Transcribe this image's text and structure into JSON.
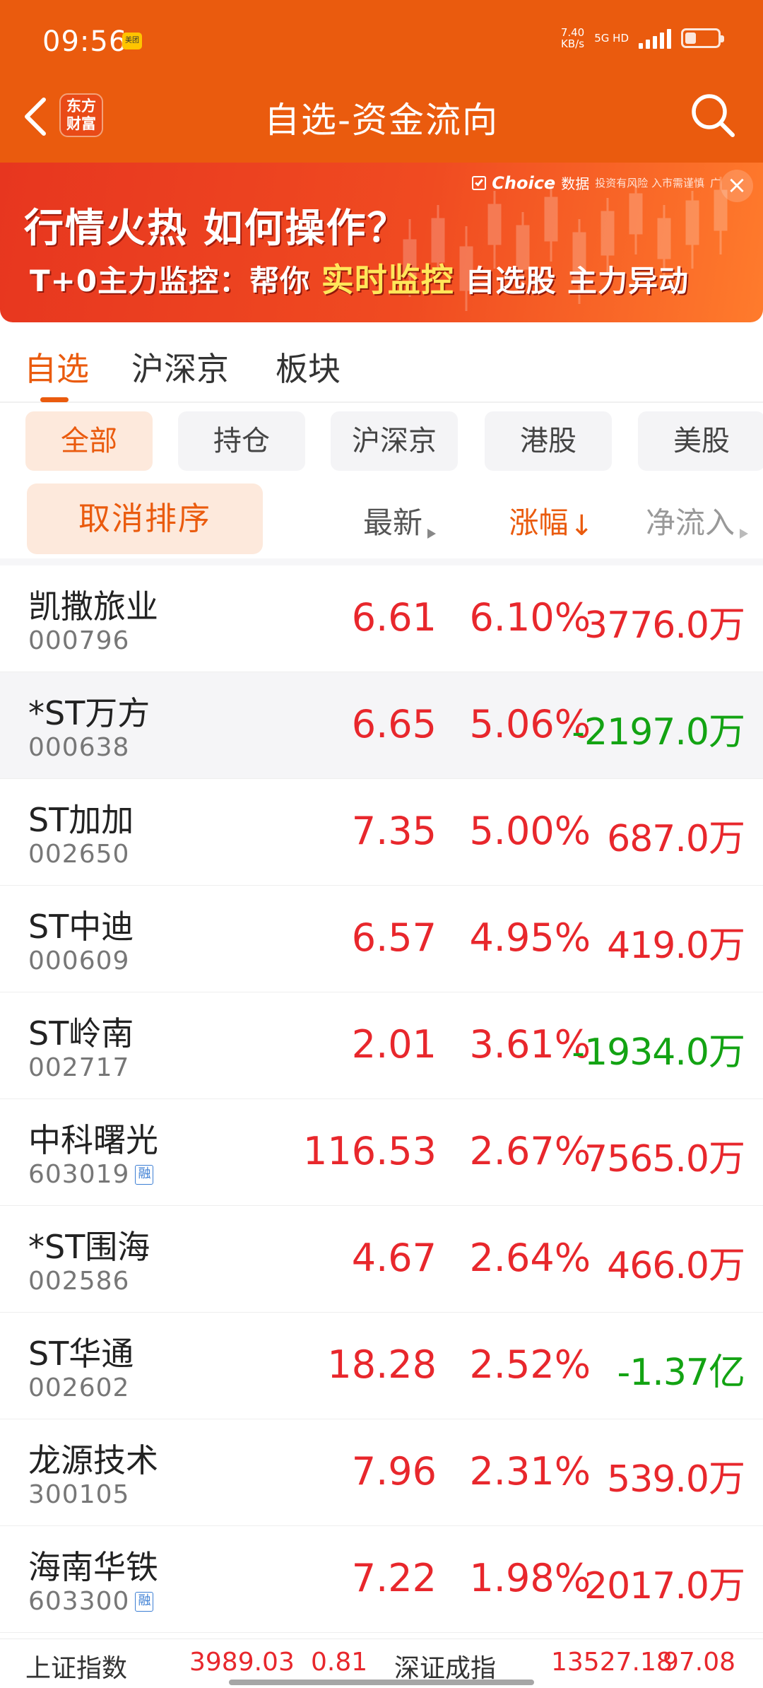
{
  "status_bar": {
    "time": "09:56",
    "app_badge": "美团",
    "net_speed_value": "7.40",
    "net_speed_unit": "KB/s",
    "net_type": "5G HD",
    "battery_level": 0.35
  },
  "header": {
    "logo_line1": "东方",
    "logo_line2": "财富",
    "title": "自选-资金流向"
  },
  "ad": {
    "brand": "Choice",
    "brand_suffix": "数据",
    "disclaimer": "投资有风险 入市需谨慎",
    "ad_tag": "广",
    "headline": "行情火热 如何操作？",
    "subline_prefix": "T+0主力监控：帮你",
    "subline_hl1": "实时监控",
    "subline_mid": "自选股",
    "subline_hl2": "主力异动"
  },
  "main_tabs": [
    {
      "label": "自选",
      "active": true
    },
    {
      "label": "沪深京",
      "active": false
    },
    {
      "label": "板块",
      "active": false
    }
  ],
  "filters": [
    {
      "label": "全部",
      "active": true
    },
    {
      "label": "持仓",
      "active": false
    },
    {
      "label": "沪深京",
      "active": false
    },
    {
      "label": "港股",
      "active": false
    },
    {
      "label": "美股",
      "active": false
    }
  ],
  "sort_bar": {
    "cancel_label": "取消排序",
    "col_latest": "最新",
    "col_change": "涨幅",
    "col_change_arrow": "↓",
    "col_netflow": "净流入"
  },
  "stocks": [
    {
      "name": "凯撒旅业",
      "code": "000796",
      "price": "6.61",
      "change": "6.10%",
      "netflow": "3776.0万",
      "direction": "up",
      "margin": false
    },
    {
      "name": "*ST万方",
      "code": "000638",
      "price": "6.65",
      "change": "5.06%",
      "netflow": "-2197.0万",
      "direction": "down",
      "margin": false
    },
    {
      "name": "ST加加",
      "code": "002650",
      "price": "7.35",
      "change": "5.00%",
      "netflow": "687.0万",
      "direction": "up",
      "margin": false
    },
    {
      "name": "ST中迪",
      "code": "000609",
      "price": "6.57",
      "change": "4.95%",
      "netflow": "419.0万",
      "direction": "up",
      "margin": false
    },
    {
      "name": "ST岭南",
      "code": "002717",
      "price": "2.01",
      "change": "3.61%",
      "netflow": "-1934.0万",
      "direction": "down",
      "margin": false
    },
    {
      "name": "中科曙光",
      "code": "603019",
      "price": "116.53",
      "change": "2.67%",
      "netflow": "7565.0万",
      "direction": "up",
      "margin": true
    },
    {
      "name": "*ST围海",
      "code": "002586",
      "price": "4.67",
      "change": "2.64%",
      "netflow": "466.0万",
      "direction": "up",
      "margin": false
    },
    {
      "name": "ST华通",
      "code": "002602",
      "price": "18.28",
      "change": "2.52%",
      "netflow": "-1.37亿",
      "direction": "down",
      "margin": false
    },
    {
      "name": "龙源技术",
      "code": "300105",
      "price": "7.96",
      "change": "2.31%",
      "netflow": "539.0万",
      "direction": "up",
      "margin": false
    },
    {
      "name": "海南华铁",
      "code": "603300",
      "price": "7.22",
      "change": "1.98%",
      "netflow": "2017.0万",
      "direction": "up",
      "margin": true
    }
  ],
  "margin_badge_label": "融",
  "index_ticker": {
    "sh_name": "上证指数",
    "sh_value": "3989.03",
    "sh_change": "0.81",
    "sz_name": "深证成指",
    "sz_value": "13527.18",
    "sz_change": "97.08"
  },
  "colors": {
    "brand_orange": "#ea5b0e",
    "up_red": "#e8272c",
    "down_green": "#13a313"
  },
  "icons": {
    "back": "chevron-left-icon",
    "search": "search-icon",
    "close": "close-icon",
    "sort": "sort-triangle-icon"
  }
}
